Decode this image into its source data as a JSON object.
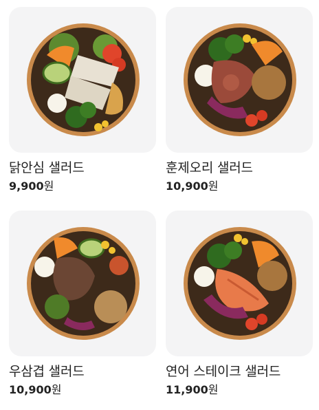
{
  "products": [
    {
      "name": "닭안심 샐러드",
      "price": "9,900",
      "currency": "원",
      "image": "chicken-tenderloin-salad-bowl"
    },
    {
      "name": "훈제오리 샐러드",
      "price": "10,900",
      "currency": "원",
      "image": "smoked-duck-salad-bowl"
    },
    {
      "name": "우삼겹 샐러드",
      "price": "10,900",
      "currency": "원",
      "image": "beef-brisket-salad-bowl"
    },
    {
      "name": "연어 스테이크 샐러드",
      "price": "11,900",
      "currency": "원",
      "image": "salmon-steak-salad-bowl"
    }
  ],
  "colors": {
    "card_bg": "#f4f4f5",
    "bowl": "#c98a4b",
    "text": "#222222"
  }
}
